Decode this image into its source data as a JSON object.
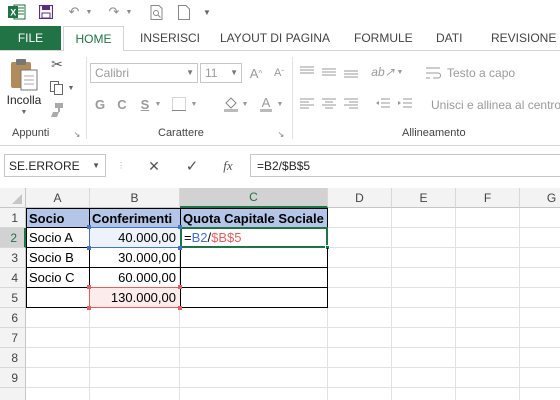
{
  "qat": {
    "app_icon": "excel-logo-icon",
    "buttons": [
      "save-icon",
      "undo-icon",
      "redo-icon",
      "print-preview-icon",
      "new-document-icon",
      "customize-qat-icon"
    ]
  },
  "tabs": {
    "file": "FILE",
    "items": [
      "HOME",
      "INSERISCI",
      "LAYOUT DI PAGINA",
      "FORMULE",
      "DATI",
      "REVISIONE"
    ],
    "active": "HOME"
  },
  "ribbon": {
    "clipboard": {
      "paste_label": "Incolla",
      "group_label": "Appunti"
    },
    "font": {
      "font_name": "Calibri",
      "font_size": "11",
      "bold": "G",
      "italic": "C",
      "underline": "S",
      "font_color_glyph": "A",
      "grow_glyph": "A",
      "shrink_glyph": "A",
      "group_label": "Carattere"
    },
    "alignment": {
      "wrap_text": "Testo a capo",
      "merge_center": "Unisci e allinea al centro",
      "group_label": "Allineamento"
    }
  },
  "formula_bar": {
    "name_box": "SE.ERRORE",
    "cancel_glyph": "✕",
    "enter_glyph": "✓",
    "fx_label": "fx",
    "formula": "=B2/$B$5"
  },
  "grid": {
    "columns": [
      "A",
      "B",
      "C",
      "D",
      "E",
      "F",
      "G"
    ],
    "rows": [
      "1",
      "2",
      "3",
      "4",
      "5",
      "6",
      "7",
      "8",
      "9"
    ],
    "cells": {
      "A1": "Socio",
      "B1": "Conferimenti",
      "C1": "Quota Capitale Sociale",
      "A2": "Socio A",
      "B2": "40.000,00",
      "A3": "Socio B",
      "B3": "30.000,00",
      "A4": "Socio C",
      "B4": "60.000,00",
      "B5": "130.000,00"
    },
    "edit_cell": {
      "address": "C2",
      "prefix": "=",
      "ref1": "B2",
      "op": "/",
      "ref2": "$B$5"
    }
  },
  "colors": {
    "brand_green": "#217346",
    "header_fill": "#b4c6e7",
    "ref1_color": "#4472c4",
    "ref2_color": "#e06060"
  }
}
